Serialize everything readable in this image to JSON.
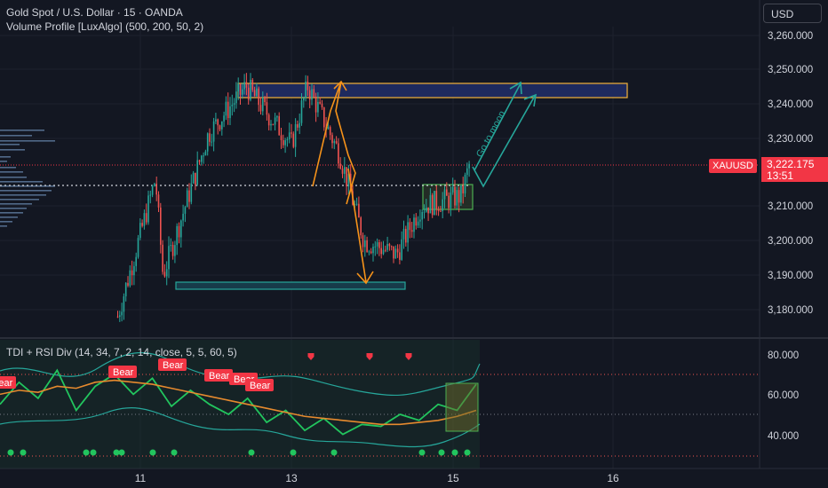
{
  "header": {
    "symbol_line": "Gold Spot / U.S. Dollar · 15 · OANDA",
    "indicator_line": "Volume Profile [LuxAlgo] (500, 200, 50, 2)",
    "currency_button": "USD"
  },
  "price_marker": {
    "symbol": "XAUUSD",
    "price": "3,222.175",
    "countdown": "13:51"
  },
  "oscillator": {
    "title": "TDI + RSI Div (14, 34, 7, 2, 14, close, 5, 5, 60, 5)",
    "signal_label": "Bear"
  },
  "annotations": {
    "arrow_text": "Go to moon"
  },
  "colors": {
    "background": "#131722",
    "up": "#26a69a",
    "down": "#ef5350",
    "zone_fill": "#1e2a5e",
    "zone_border": "#f5b33a",
    "support_border": "#26a69a",
    "orange": "#f7931a",
    "green_line": "#22c55e"
  },
  "chart_data": [
    {
      "type": "candlestick",
      "title": "Gold Spot / U.S. Dollar · 15 · OANDA",
      "x_ticks": [
        "11",
        "13",
        "15",
        "16"
      ],
      "y_ticks": [
        "3,260.000",
        "3,250.000",
        "3,240.000",
        "3,230.000",
        "3,210.000",
        "3,200.000",
        "3,190.000",
        "3,180.000"
      ],
      "ylim": [
        3176,
        3265
      ],
      "last_price": 3222.175,
      "resistance_zone": [
        3242.5,
        3246.5
      ],
      "support_zone": [
        3187.5,
        3189.5
      ],
      "dotted_level": 3216.5,
      "key_points": [
        {
          "x": "10.7",
          "y": 3178
        },
        {
          "x": "11.2",
          "y": 3218
        },
        {
          "x": "11.3",
          "y": 3190
        },
        {
          "x": "11.9",
          "y": 3231
        },
        {
          "x": "12.4",
          "y": 3245
        },
        {
          "x": "13.0",
          "y": 3228
        },
        {
          "x": "13.2",
          "y": 3245
        },
        {
          "x": "13.6",
          "y": 3225
        },
        {
          "x": "13.9",
          "y": 3200
        },
        {
          "x": "14.3",
          "y": 3196
        },
        {
          "x": "14.6",
          "y": 3210
        },
        {
          "x": "15.1",
          "y": 3213
        },
        {
          "x": "15.2",
          "y": 3222
        }
      ],
      "projection": {
        "from": 3216,
        "to": 3245
      }
    },
    {
      "type": "line",
      "title": "TDI + RSI Div (14, 34, 7, 2, 14, close, 5, 5, 60, 5)",
      "y_ticks": [
        "80.000",
        "60.000",
        "40.000"
      ],
      "ylim": [
        28,
        90
      ],
      "reference_levels": [
        70,
        50,
        32
      ],
      "series": [
        {
          "values": [
            55,
            66,
            58,
            72,
            52,
            64,
            70,
            60,
            68,
            54,
            62,
            55,
            50,
            58,
            46,
            52,
            42,
            48,
            40,
            45,
            44,
            50,
            47,
            55,
            52,
            65
          ]
        },
        {
          "values": [
            60,
            62,
            61,
            64,
            63,
            66,
            67,
            66,
            65,
            63,
            61,
            59,
            57,
            55,
            53,
            51,
            49,
            48,
            47,
            46,
            45,
            45,
            46,
            47,
            49,
            52
          ]
        }
      ]
    }
  ]
}
